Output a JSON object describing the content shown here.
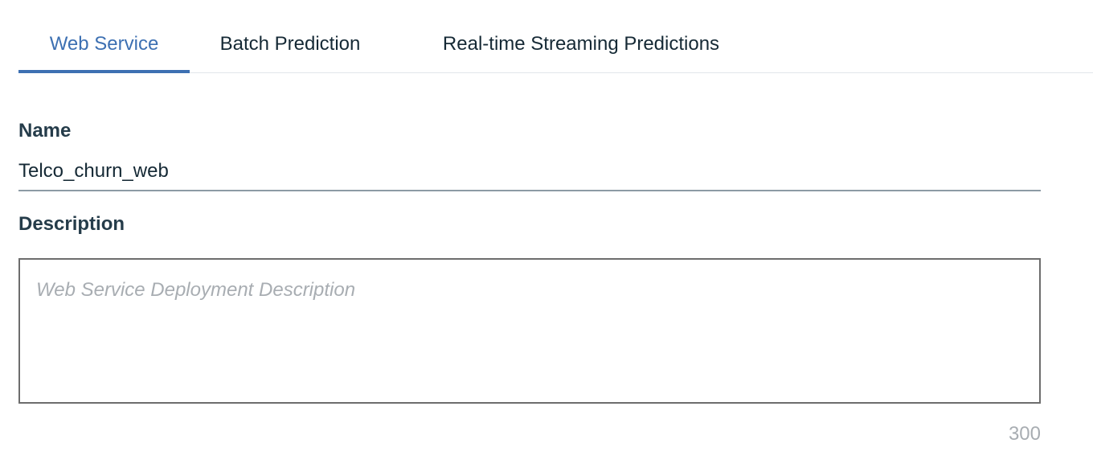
{
  "tabs": [
    {
      "label": "Web Service",
      "active": true
    },
    {
      "label": "Batch Prediction",
      "active": false
    },
    {
      "label": "Real-time Streaming Predictions",
      "active": false
    }
  ],
  "form": {
    "name_label": "Name",
    "name_value": "Telco_churn_web",
    "description_label": "Description",
    "description_placeholder": "Web Service Deployment Description",
    "description_value": "",
    "char_count": "300"
  },
  "colors": {
    "accent": "#3d70b2",
    "text": "#152935",
    "muted": "#a8adb2"
  }
}
